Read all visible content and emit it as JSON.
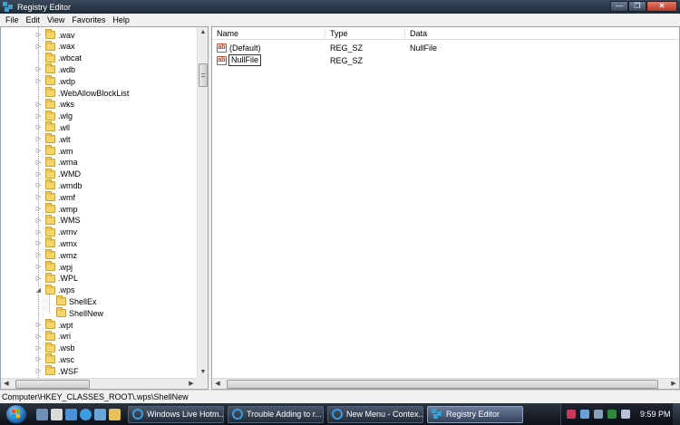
{
  "window": {
    "title": "Registry Editor"
  },
  "controls": {
    "minimize": "—",
    "maximize": "❐",
    "close": "✕"
  },
  "menu": [
    "File",
    "Edit",
    "View",
    "Favorites",
    "Help"
  ],
  "tree": {
    "items": [
      {
        "label": ".wav",
        "level": 0,
        "expandable": true
      },
      {
        "label": ".wax",
        "level": 0,
        "expandable": true
      },
      {
        "label": ".wbcat",
        "level": 0,
        "expandable": false
      },
      {
        "label": ".wdb",
        "level": 0,
        "expandable": true
      },
      {
        "label": ".wdp",
        "level": 0,
        "expandable": true
      },
      {
        "label": ".WebAllowBlockList",
        "level": 0,
        "expandable": false
      },
      {
        "label": ".wks",
        "level": 0,
        "expandable": true
      },
      {
        "label": ".wlg",
        "level": 0,
        "expandable": true
      },
      {
        "label": ".wll",
        "level": 0,
        "expandable": true
      },
      {
        "label": ".wlt",
        "level": 0,
        "expandable": true
      },
      {
        "label": ".wm",
        "level": 0,
        "expandable": true
      },
      {
        "label": ".wma",
        "level": 0,
        "expandable": true
      },
      {
        "label": ".WMD",
        "level": 0,
        "expandable": true
      },
      {
        "label": ".wmdb",
        "level": 0,
        "expandable": true
      },
      {
        "label": ".wmf",
        "level": 0,
        "expandable": true
      },
      {
        "label": ".wmp",
        "level": 0,
        "expandable": true
      },
      {
        "label": ".WMS",
        "level": 0,
        "expandable": true
      },
      {
        "label": ".wmv",
        "level": 0,
        "expandable": true
      },
      {
        "label": ".wmx",
        "level": 0,
        "expandable": true
      },
      {
        "label": ".wmz",
        "level": 0,
        "expandable": true
      },
      {
        "label": ".wpj",
        "level": 0,
        "expandable": true
      },
      {
        "label": ".WPL",
        "level": 0,
        "expandable": true
      },
      {
        "label": ".wps",
        "level": 0,
        "expandable": true,
        "expanded": true
      },
      {
        "label": "ShellEx",
        "level": 1,
        "expandable": false
      },
      {
        "label": "ShellNew",
        "level": 1,
        "expandable": false
      },
      {
        "label": ".wpt",
        "level": 0,
        "expandable": true
      },
      {
        "label": ".wri",
        "level": 0,
        "expandable": true
      },
      {
        "label": ".wsb",
        "level": 0,
        "expandable": true
      },
      {
        "label": ".wsc",
        "level": 0,
        "expandable": true
      },
      {
        "label": ".WSF",
        "level": 0,
        "expandable": true
      }
    ]
  },
  "values": {
    "columns": [
      "Name",
      "Type",
      "Data"
    ],
    "rows": [
      {
        "name": "(Default)",
        "type": "REG_SZ",
        "data": "NullFile",
        "icon": "string-value-icon"
      },
      {
        "name": "NullFile",
        "type": "REG_SZ",
        "data": "",
        "icon": "string-value-icon",
        "renaming": true
      }
    ]
  },
  "status": {
    "path": "Computer\\HKEY_CLASSES_ROOT\\.wps\\ShellNew"
  },
  "taskbar": {
    "buttons": [
      {
        "label": "Windows Live Hotm...",
        "icon": "ie-icon"
      },
      {
        "label": "Trouble Adding to r...",
        "icon": "ie-icon"
      },
      {
        "label": "New Menu - Contex...",
        "icon": "ie-icon"
      },
      {
        "label": "Registry Editor",
        "icon": "regedit-icon",
        "active": true
      }
    ],
    "clock": "9:59 PM"
  },
  "colors": {
    "accent": "#3aa0d0",
    "folder": "#f3d56b",
    "taskbar": "#1e2530"
  }
}
